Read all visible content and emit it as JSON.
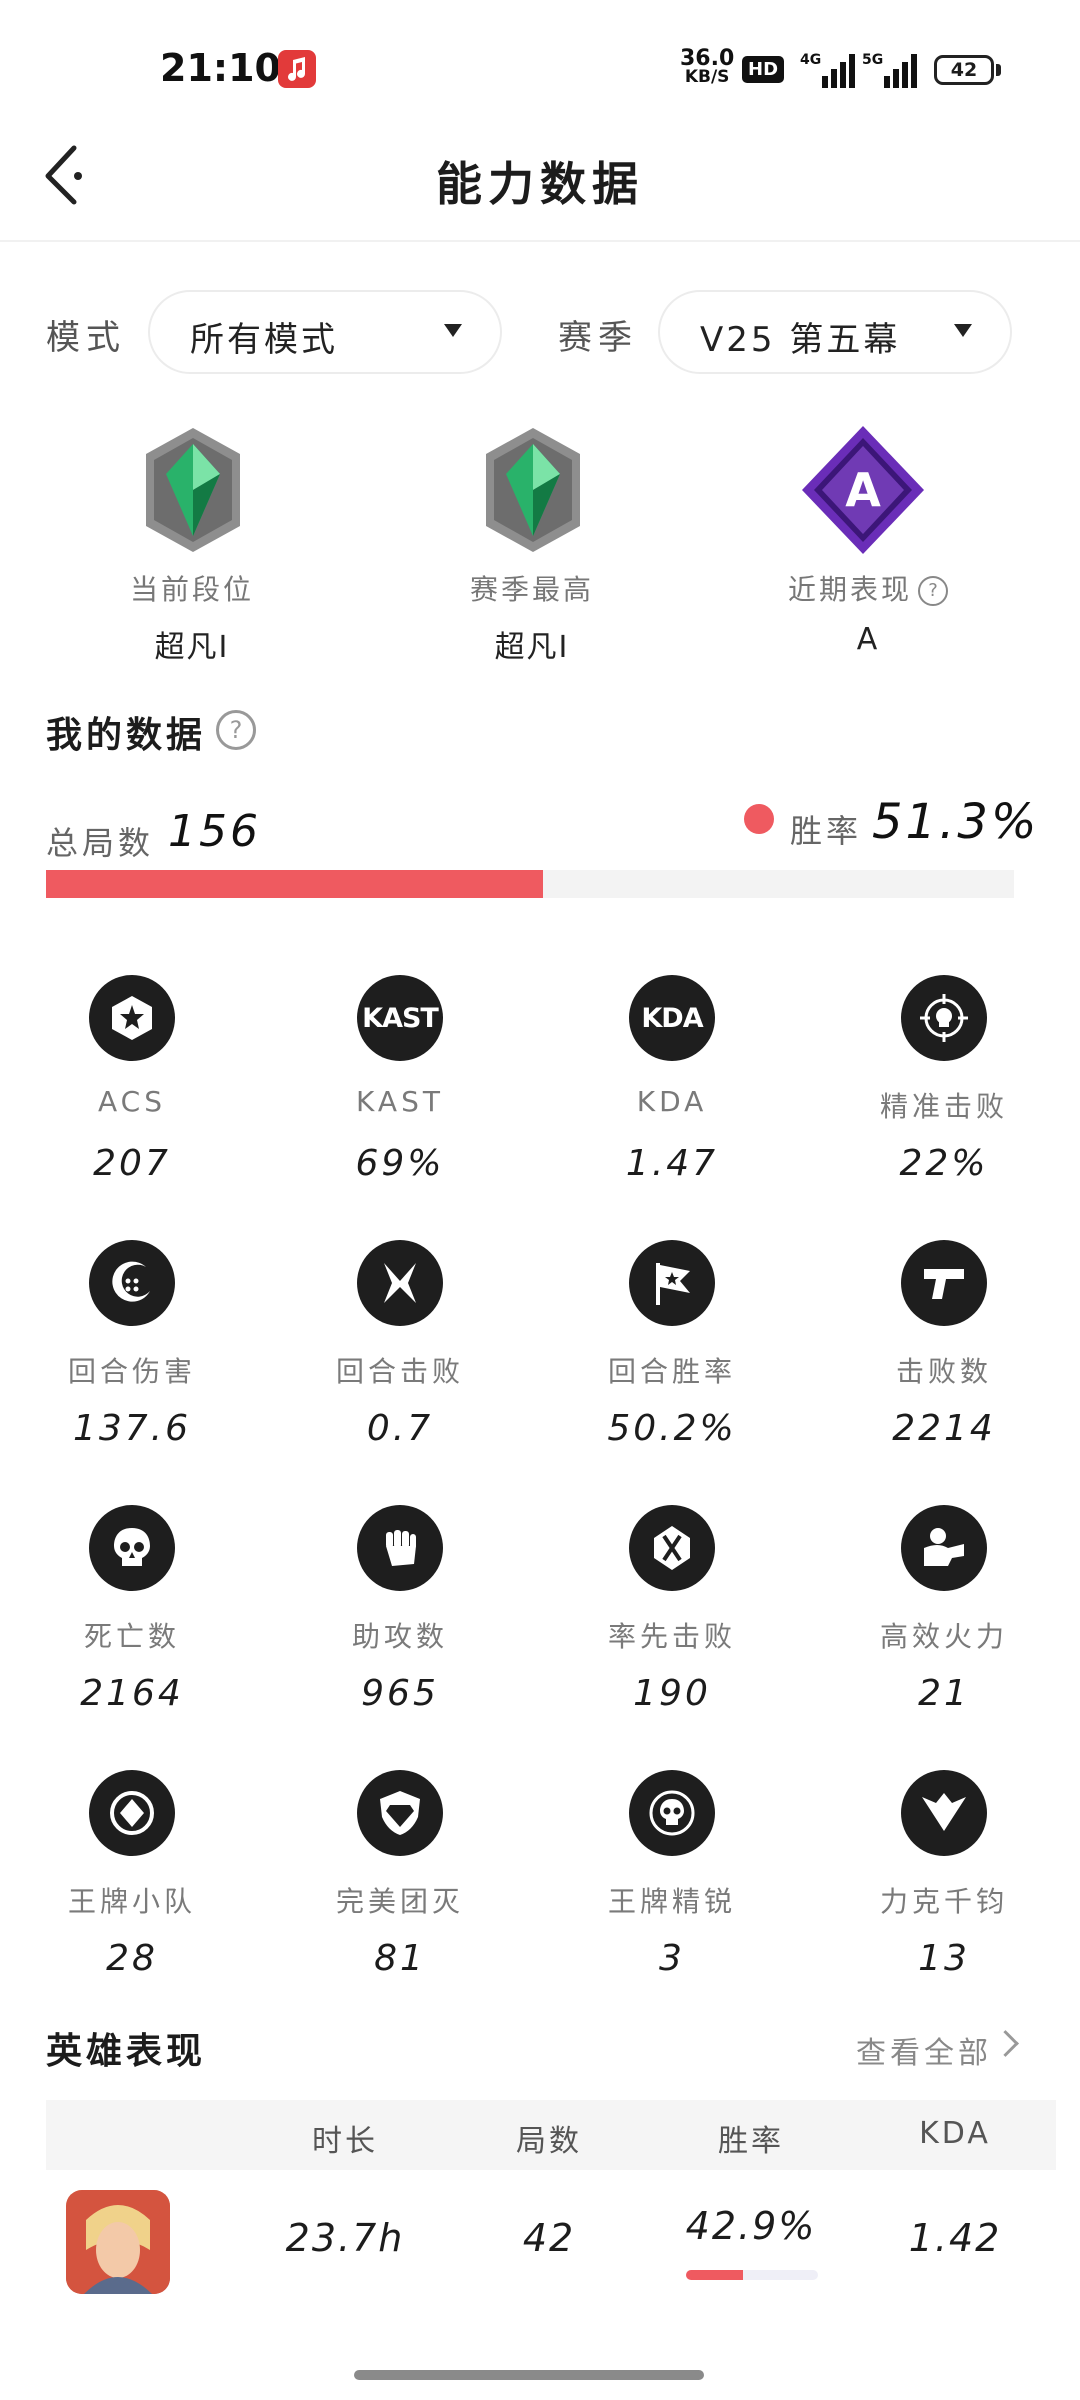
{
  "status_bar": {
    "time": "21:10",
    "net_speed_value": "36.0",
    "net_speed_unit": "KB/S",
    "hd_badge": "HD",
    "network_1": "4G",
    "network_2": "5G",
    "battery": "42",
    "icons": [
      "music-app-icon",
      "signal-icon",
      "battery-icon"
    ]
  },
  "header": {
    "title": "能力数据",
    "back_icon": "back-icon"
  },
  "filters": {
    "mode_label": "模式",
    "mode_value": "所有模式",
    "season_label": "赛季",
    "season_value": "V25 第五幕"
  },
  "ranks": [
    {
      "label": "当前段位",
      "value": "超凡Ⅰ",
      "icon": "ascendant-rank-icon"
    },
    {
      "label": "赛季最高",
      "value": "超凡Ⅰ",
      "icon": "ascendant-rank-icon"
    },
    {
      "label": "近期表现",
      "value": "A",
      "icon": "performance-a-icon"
    }
  ],
  "my_data": {
    "title": "我的数据",
    "total_games_label": "总局数",
    "total_games_value": "156",
    "win_rate_label": "胜率",
    "win_rate_value": "51.3%",
    "win_rate_fraction": 0.513,
    "win_color": "#ef5a60"
  },
  "stats": [
    {
      "icon": "star-hexagon-icon",
      "icon_text": "",
      "label": "ACS",
      "value": "207"
    },
    {
      "icon": "kast-icon",
      "icon_text": "KAST",
      "label": "KAST",
      "value": "69%"
    },
    {
      "icon": "kda-icon",
      "icon_text": "KDA",
      "label": "KDA",
      "value": "1.47"
    },
    {
      "icon": "crosshair-skull-icon",
      "icon_text": "",
      "label": "精准击败",
      "value": "22%"
    },
    {
      "icon": "moon-damage-icon",
      "icon_text": "",
      "label": "回合伤害",
      "value": "137.6"
    },
    {
      "icon": "crossed-blades-icon",
      "icon_text": "",
      "label": "回合击败",
      "value": "0.7"
    },
    {
      "icon": "victory-flag-icon",
      "icon_text": "",
      "label": "回合胜率",
      "value": "50.2%"
    },
    {
      "icon": "pistol-icon",
      "icon_text": "",
      "label": "击败数",
      "value": "2214"
    },
    {
      "icon": "skull-icon",
      "icon_text": "",
      "label": "死亡数",
      "value": "2164"
    },
    {
      "icon": "fist-icon",
      "icon_text": "",
      "label": "助攻数",
      "value": "965"
    },
    {
      "icon": "first-blood-icon",
      "icon_text": "",
      "label": "率先击败",
      "value": "190"
    },
    {
      "icon": "firepower-icon",
      "icon_text": "",
      "label": "高效火力",
      "value": "21"
    },
    {
      "icon": "ace-squad-icon",
      "icon_text": "",
      "label": "王牌小队",
      "value": "28"
    },
    {
      "icon": "diamond-shield-icon",
      "icon_text": "",
      "label": "完美团灭",
      "value": "81"
    },
    {
      "icon": "ace-elite-skull-icon",
      "icon_text": "",
      "label": "王牌精锐",
      "value": "3"
    },
    {
      "icon": "wings-icon",
      "icon_text": "",
      "label": "力克千钧",
      "value": "13"
    }
  ],
  "heroes": {
    "title": "英雄表现",
    "view_all": "查看全部",
    "columns": [
      "时长",
      "局数",
      "胜率",
      "KDA"
    ],
    "rows": [
      {
        "avatar": "hero-avatar",
        "duration": "23.7h",
        "games": "42",
        "win_rate": "42.9%",
        "win_fraction": 0.429,
        "kda": "1.42"
      }
    ]
  }
}
